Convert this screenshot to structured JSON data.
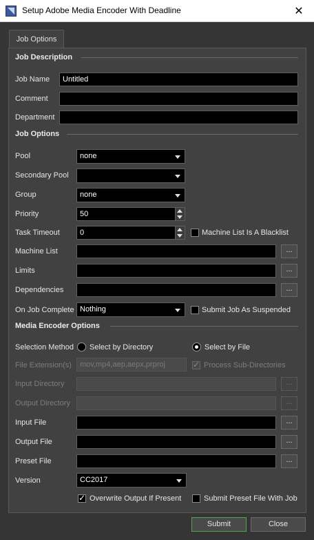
{
  "window": {
    "title": "Setup Adobe Media Encoder With Deadline",
    "close_glyph": "✕"
  },
  "tabs": [
    {
      "label": "Job Options"
    }
  ],
  "job_description": {
    "heading": "Job Description",
    "job_name": {
      "label": "Job Name",
      "value": "Untitled"
    },
    "comment": {
      "label": "Comment",
      "value": ""
    },
    "department": {
      "label": "Department",
      "value": ""
    }
  },
  "job_options": {
    "heading": "Job Options",
    "pool": {
      "label": "Pool",
      "value": "none"
    },
    "secondary_pool": {
      "label": "Secondary Pool",
      "value": ""
    },
    "group": {
      "label": "Group",
      "value": "none"
    },
    "priority": {
      "label": "Priority",
      "value": "50"
    },
    "task_timeout": {
      "label": "Task Timeout",
      "value": "0"
    },
    "machine_list_blacklist": {
      "label": "Machine List Is A Blacklist",
      "checked": false
    },
    "machine_list": {
      "label": "Machine List",
      "value": ""
    },
    "limits": {
      "label": "Limits",
      "value": ""
    },
    "dependencies": {
      "label": "Dependencies",
      "value": ""
    },
    "on_job_complete": {
      "label": "On Job Complete",
      "value": "Nothing"
    },
    "submit_suspended": {
      "label": "Submit Job As Suspended",
      "checked": false
    },
    "browse_label": "..."
  },
  "media_encoder_options": {
    "heading": "Media Encoder Options",
    "selection_method": {
      "label": "Selection Method",
      "by_directory": "Select by Directory",
      "by_file": "Select by File",
      "selected": "by_file"
    },
    "file_extensions": {
      "label": "File Extension(s)",
      "value": "mov,mp4,aep,aepx,prproj"
    },
    "process_subdirs": {
      "label": "Process Sub-Directories",
      "checked": true
    },
    "input_directory": {
      "label": "Input Directory",
      "value": ""
    },
    "output_directory": {
      "label": "Output Directory",
      "value": ""
    },
    "input_file": {
      "label": "Input File",
      "value": ""
    },
    "output_file": {
      "label": "Output File",
      "value": ""
    },
    "preset_file": {
      "label": "Preset File",
      "value": ""
    },
    "version": {
      "label": "Version",
      "value": "CC2017"
    },
    "overwrite_output": {
      "label": "Overwrite Output If Present",
      "checked": true
    },
    "submit_preset": {
      "label": "Submit Preset File With Job",
      "checked": false
    }
  },
  "footer": {
    "submit_label": "Submit",
    "close_label": "Close"
  },
  "colors": {
    "background": "#353535",
    "panel": "#414141",
    "field": "#000000",
    "accent_border": "#4fa64f"
  }
}
